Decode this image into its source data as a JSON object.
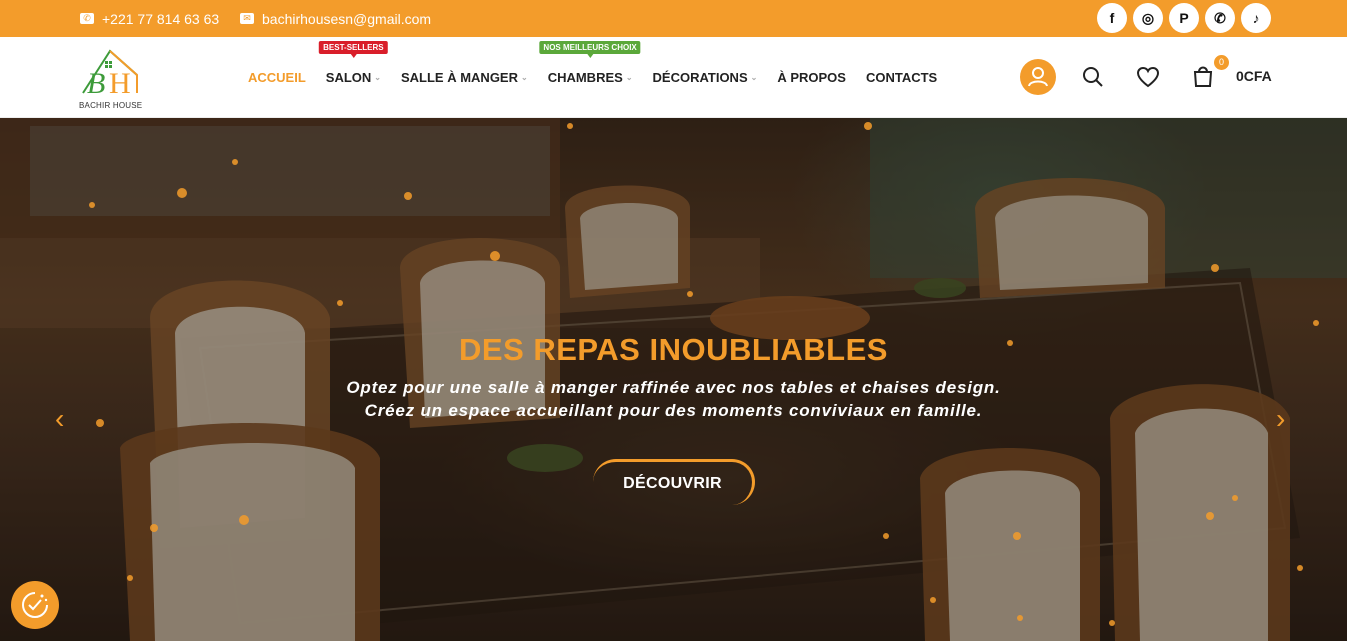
{
  "topbar": {
    "phone": "+221 77 814 63 63",
    "email": "bachirhousesn@gmail.com",
    "social": [
      {
        "icon": "facebook-icon",
        "glyph": "f"
      },
      {
        "icon": "instagram-icon",
        "glyph": "◎"
      },
      {
        "icon": "pinterest-icon",
        "glyph": "P"
      },
      {
        "icon": "whatsapp-icon",
        "glyph": "✆"
      },
      {
        "icon": "tiktok-icon",
        "glyph": "♪"
      }
    ]
  },
  "brand": {
    "logo_letters": "BH",
    "name": "BACHIR HOUSE",
    "color": "#f39c2b",
    "green": "#3d9b3a"
  },
  "nav": {
    "items": [
      {
        "label": "ACCUEIL",
        "active": true
      },
      {
        "label": "SALON",
        "badge": "BEST-SELLERS"
      },
      {
        "label": "SALLE À MANGER"
      },
      {
        "label": "CHAMBRES",
        "badge": "NOS MEILLEURS CHOIX"
      },
      {
        "label": "DÉCORATIONS"
      },
      {
        "label": "À PROPOS"
      },
      {
        "label": "CONTACTS"
      }
    ]
  },
  "cart": {
    "count": "0",
    "total": "0CFA"
  },
  "hero": {
    "title": "DES REPAS INOUBLIABLES",
    "line1": "Optez pour une salle à manger raffinée avec nos tables et chaises design.",
    "line2": "Créez un espace accueillant pour des moments conviviaux en famille.",
    "cta": "DÉCOUVRIR"
  }
}
